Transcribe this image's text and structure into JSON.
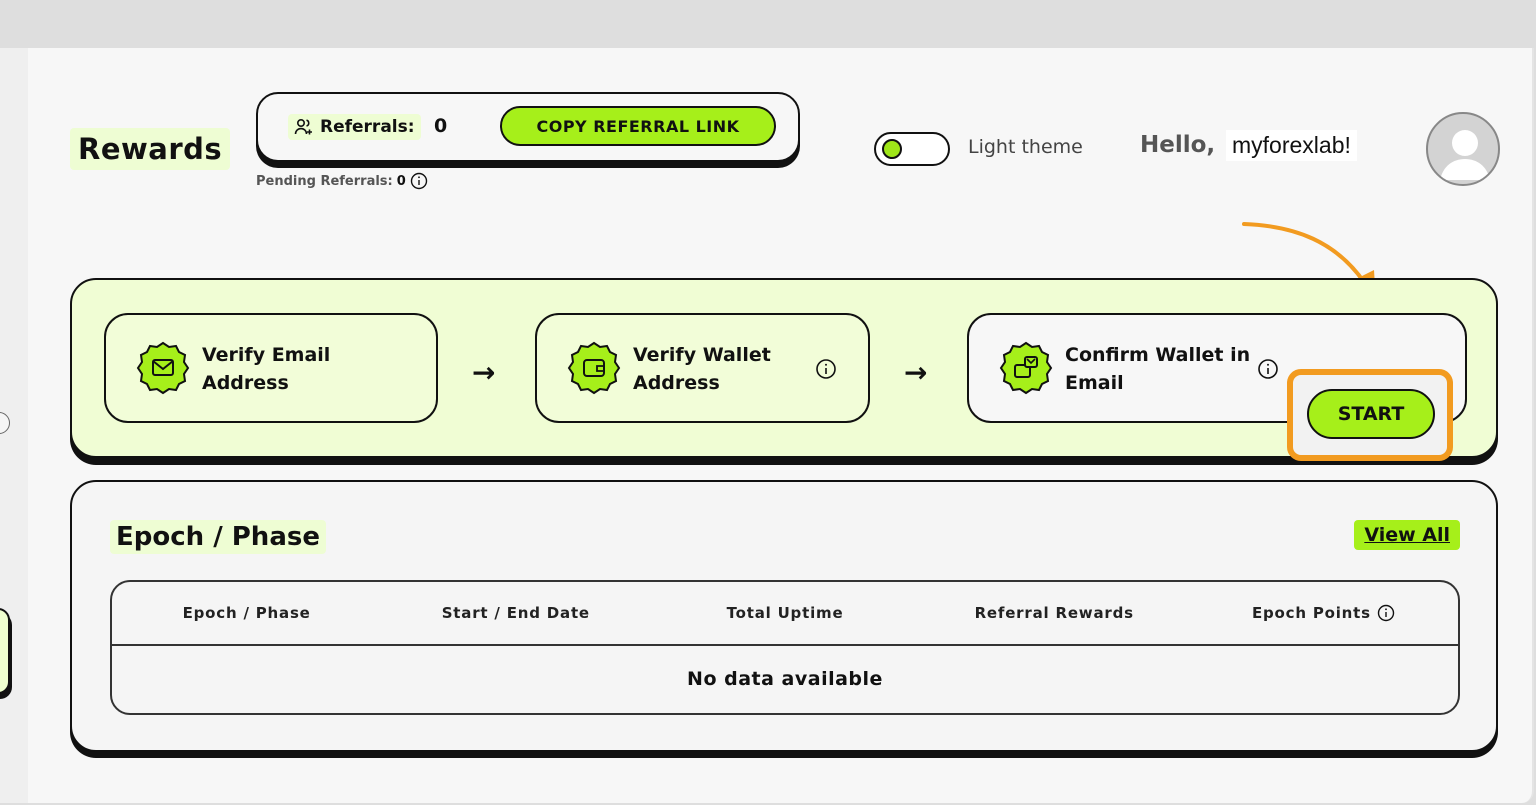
{
  "header": {
    "title": "Rewards",
    "referrals_label": "Referrals:",
    "referrals_count": "0",
    "copy_button": "COPY REFERRAL LINK",
    "pending_label": "Pending Referrals:",
    "pending_count": "0",
    "theme_label": "Light theme",
    "greeting": "Hello,",
    "username": "myforexlab!"
  },
  "steps": [
    {
      "label": "Verify Email Address",
      "icon": "email-icon"
    },
    {
      "label": "Verify Wallet Address",
      "icon": "wallet-icon"
    },
    {
      "label": "Confirm Wallet in Email",
      "icon": "confirm-wallet-icon",
      "action": "START"
    }
  ],
  "epoch": {
    "title": "Epoch / Phase",
    "view_all": "View All",
    "columns": [
      "Epoch / Phase",
      "Start / End Date",
      "Total Uptime",
      "Referral Rewards",
      "Epoch Points"
    ],
    "empty_text": "No data available"
  },
  "colors": {
    "accent_green": "#a6ef1a",
    "panel_green": "#f0fdd4",
    "highlight_orange": "#f29b20"
  }
}
